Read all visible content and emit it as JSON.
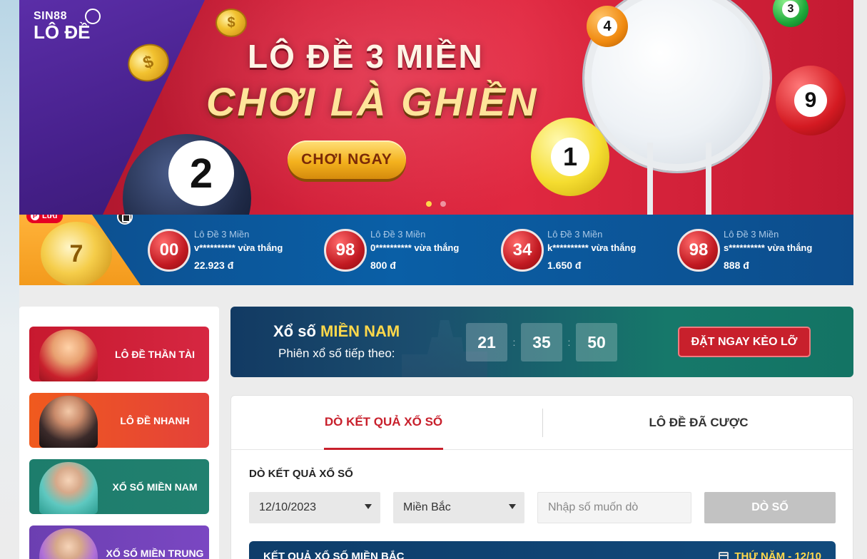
{
  "hero": {
    "logo_brand": "SIN88",
    "logo_product": "LÔ ĐỀ",
    "title_line1": "LÔ ĐỀ 3 MIỀN",
    "title_line2": "CHƠI LÀ GHIỀN",
    "cta_label": "CHƠI NGAY",
    "ball_left_number": "2",
    "ball_yellow_number": "1",
    "ball_orange_number": "4",
    "ball_red_number": "9",
    "ball_green_number": "3",
    "trophy_number": "7"
  },
  "overlay": {
    "pin_save_label": "Lưu"
  },
  "winners": [
    {
      "number": "00",
      "game": "Lô Đề 3 Miền",
      "user": "v********** vừa thắng",
      "amount": "22.923 đ"
    },
    {
      "number": "98",
      "game": "Lô Đề 3 Miền",
      "user": "0********** vừa thắng",
      "amount": "800 đ"
    },
    {
      "number": "34",
      "game": "Lô Đề 3 Miền",
      "user": "k********** vừa thắng",
      "amount": "1.650 đ"
    },
    {
      "number": "98",
      "game": "Lô Đề 3 Miền",
      "user": "s********** vừa thắng",
      "amount": "888 đ"
    }
  ],
  "sidebar": {
    "items": [
      {
        "label": "LÔ ĐỀ THẦN TÀI"
      },
      {
        "label": "LÔ ĐỀ NHANH"
      },
      {
        "label": "XỔ SỐ MIỀN NAM"
      },
      {
        "label": "XỔ SỐ MIỀN TRUNG"
      }
    ]
  },
  "draw": {
    "title_prefix": "Xổ số",
    "title_region": "MIỀN NAM",
    "subtitle": "Phiên xổ số tiếp theo:",
    "hours": "21",
    "minutes": "35",
    "seconds": "50",
    "separator": ":",
    "bet_label": "ĐẶT NGAY KẺO LỠ"
  },
  "panel": {
    "tab_results": "DÒ KẾT QUẢ XỔ SỐ",
    "tab_bets": "LÔ ĐỀ ĐÃ CƯỢC",
    "section_title": "DÒ KẾT QUẢ XỔ SỐ",
    "date_value": "12/10/2023",
    "region_value": "Miền Bắc",
    "number_placeholder": "Nhập số muốn dò",
    "search_label": "DÒ SỐ",
    "results_title": "KẾT QUẢ XỔ SỐ MIỀN BẮC",
    "results_date": "THỨ NĂM - 12/10"
  },
  "colors": {
    "accent_red": "#c8202c",
    "highlight_yellow": "#ffd84a",
    "navy": "#0e3d6a",
    "teal": "#137464"
  }
}
